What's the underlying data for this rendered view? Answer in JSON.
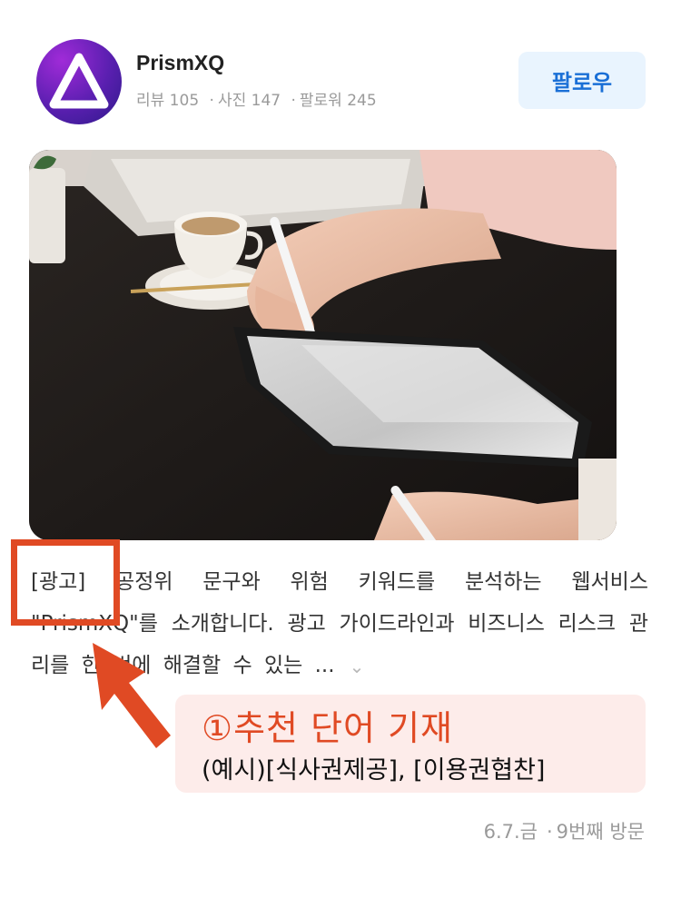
{
  "profile": {
    "username": "PrismXQ",
    "stats": {
      "reviews": "리뷰 105",
      "photos": "사진 147",
      "followers": "팔로워 245",
      "separator": "·"
    },
    "follow_label": "팔로우",
    "avatar_icon": "triangle-logo-icon"
  },
  "review": {
    "photo_icon": "tablet-desk-photo",
    "ad_tag": "[광고]",
    "text": " 공정위 문구와 위험 키워드를 분석하는 웹서비스 \"PrismXQ\"를 소개합니다. 광고 가이드라인과 비즈니스 리스크 관리를 한 번에 해결할 수 있는 ...",
    "more_icon": "chevron-down-icon"
  },
  "annotation": {
    "title": "①추천 단어 기재",
    "example": "(예시)[식사권제공], [이용권협찬]",
    "color": "#e04a24",
    "arrow_icon": "arrow-pointer-icon"
  },
  "footer": {
    "date": "6.7.금",
    "separator": "·",
    "visit": "9번째 방문"
  },
  "colors": {
    "accent": "#1a6fd6",
    "follow_bg": "#e9f4fe",
    "annotation": "#e04a24",
    "callout_bg": "#fdecea"
  }
}
